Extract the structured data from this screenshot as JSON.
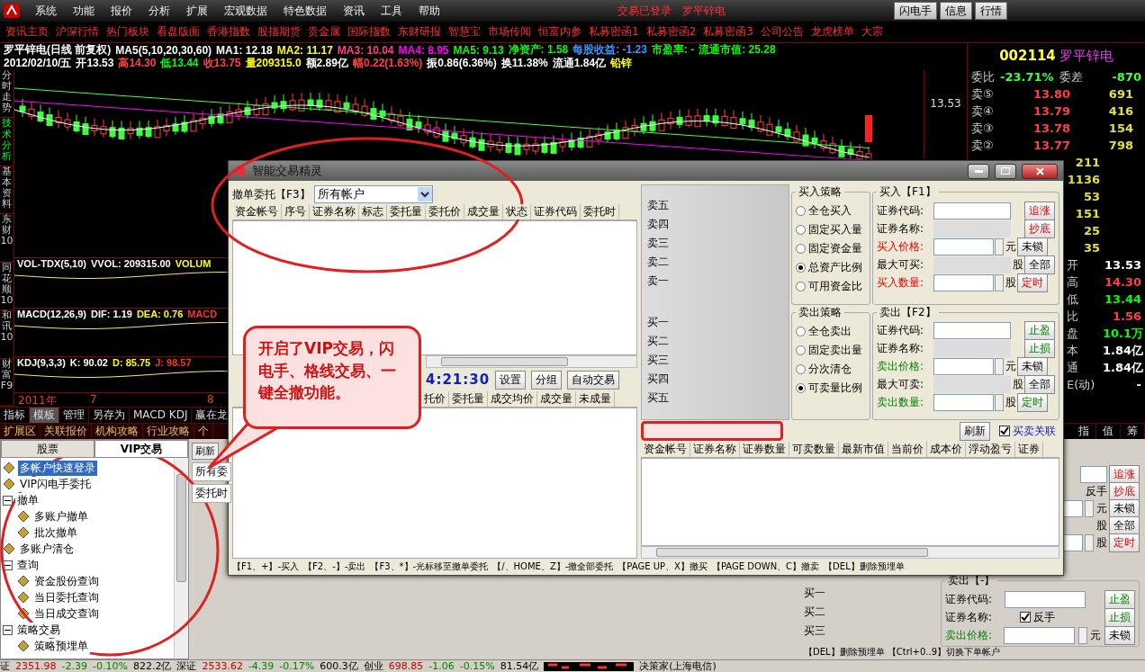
{
  "menu": {
    "items": [
      "系统",
      "功能",
      "报价",
      "分析",
      "扩展",
      "宏观数据",
      "特色数据",
      "资讯",
      "工具",
      "帮助"
    ],
    "status": "交易已登录",
    "stock": "罗平锌电",
    "buttons": [
      "闪电手",
      "信息",
      "行情"
    ]
  },
  "links": [
    "资讯主页",
    "沪深行情",
    "热门板块",
    "看盘版面",
    "香港指数",
    "股指期货",
    "贵金属",
    "国际指数",
    "东财研报",
    "智慧宝",
    "市场传闻",
    "恒富内参",
    "私募密函1",
    "私募密函2",
    "私募密函3",
    "公司公告",
    "龙虎榜单",
    "大宗"
  ],
  "chart": {
    "line1": [
      {
        "text": "罗平锌电(日线 前复权)",
        "color": "#ffffff"
      },
      {
        "text": "MA5(5,10,20,30,60)",
        "color": "#ffffff"
      },
      {
        "text": "MA1: 12.18",
        "color": "#ffffff"
      },
      {
        "text": "MA2: 11.17",
        "color": "#ffff00"
      },
      {
        "text": "MA3: 10.04",
        "color": "#ff4080"
      },
      {
        "text": "MA4: 8.95",
        "color": "#ff00ff"
      },
      {
        "text": "MA5: 9.13",
        "color": "#00ff00"
      },
      {
        "text": "净资产: 1.58",
        "color": "#00ff00"
      },
      {
        "text": "每股收益: -1.23",
        "color": "#3399ff"
      },
      {
        "text": "市盈率: -",
        "color": "#00ff00"
      },
      {
        "text": "流通市值: 25.28",
        "color": "#00ff00"
      }
    ],
    "line2": [
      {
        "text": "2012/02/10/五",
        "color": "#ffffff"
      },
      {
        "text": "开13.53",
        "color": "#ffffff"
      },
      {
        "text": "高14.30",
        "color": "#ff4040"
      },
      {
        "text": "低13.44",
        "color": "#00ff00"
      },
      {
        "text": "收13.75",
        "color": "#ff4040"
      },
      {
        "text": "量209315.0",
        "color": "#ffff00"
      },
      {
        "text": "额2.89亿",
        "color": "#ffffff"
      },
      {
        "text": "幅0.22(1.63%)",
        "color": "#ff4040"
      },
      {
        "text": "振0.86(6.36%)",
        "color": "#ffffff"
      },
      {
        "text": "换11.38%",
        "color": "#ffffff"
      },
      {
        "text": "流通1.84亿",
        "color": "#ffffff"
      },
      {
        "text": "铅锌",
        "color": "#ffff00"
      }
    ],
    "price_label": "13.53",
    "side_tabs": [
      {
        "label": "分时走势",
        "selected": false
      },
      {
        "label": "技术分析",
        "selected": true
      },
      {
        "label": "基本资料",
        "selected": false
      },
      {
        "label": "东财10",
        "selected": false
      },
      {
        "label": "同花顺10",
        "selected": false
      },
      {
        "label": "和讯10",
        "selected": false
      },
      {
        "label": "财富F9",
        "selected": false
      }
    ],
    "indicators": [
      [
        {
          "text": "VOL-TDX(5,10)",
          "color": "#ffffff"
        },
        {
          "text": "VVOL: 209315.00",
          "color": "#ffffff"
        },
        {
          "text": "VOLUM",
          "color": "#ffff00"
        }
      ],
      [
        {
          "text": "MACD(12,26,9)",
          "color": "#ffffff"
        },
        {
          "text": "DIF: 1.19",
          "color": "#ffffff"
        },
        {
          "text": "DEA: 0.76",
          "color": "#ffff00"
        },
        {
          "text": "MACD",
          "color": "#ff3030"
        }
      ],
      [
        {
          "text": "KDJ(9,3,3)",
          "color": "#ffffff"
        },
        {
          "text": "K: 90.02",
          "color": "#ffffff"
        },
        {
          "text": "D: 85.75",
          "color": "#ffff00"
        },
        {
          "text": "J: 98.57",
          "color": "#ff3030"
        }
      ]
    ],
    "axis": [
      "2011年",
      "7",
      "8"
    ],
    "tabs": [
      {
        "label": "指标",
        "selected": false
      },
      {
        "label": "模板",
        "selected": true
      },
      {
        "label": "管理",
        "selected": false
      },
      {
        "label": "另存为",
        "selected": false
      },
      {
        "label": "MACD KDJ",
        "selected": false
      },
      {
        "label": "赢在龙",
        "selected": false
      }
    ],
    "ext_tabs": [
      "扩展区",
      "关联报价",
      "机构攻略",
      "行业攻略",
      "个"
    ]
  },
  "quote": {
    "code": "002114",
    "name": "罗平锌电",
    "ratio_label": "委比",
    "ratio": "-23.71%",
    "diff_label": "委差",
    "diff": "-870",
    "asks": [
      {
        "label": "卖⑤",
        "price": "13.80",
        "volume": "691"
      },
      {
        "label": "卖④",
        "price": "13.79",
        "volume": "416"
      },
      {
        "label": "卖③",
        "price": "13.78",
        "volume": "154"
      },
      {
        "label": "卖②",
        "price": "13.77",
        "volume": "798"
      }
    ],
    "volumes": [
      "211",
      "1136",
      "53",
      "151",
      "25",
      "35"
    ],
    "stats": [
      {
        "label": "开",
        "value": "13.53",
        "color": "#ffffff"
      },
      {
        "label": "高",
        "value": "14.30",
        "color": "#ff4040"
      },
      {
        "label": "低",
        "value": "13.44",
        "color": "#00ff00"
      },
      {
        "label": "比",
        "value": "1.56",
        "color": "#ff4040"
      },
      {
        "label": "盘",
        "value": "10.1万",
        "color": "#00ff00"
      },
      {
        "label": "本",
        "value": "1.84亿",
        "color": "#ffffff"
      },
      {
        "label": "通",
        "value": "1.84亿",
        "color": "#ffffff"
      },
      {
        "label": "E(动)",
        "value": "-",
        "color": "#ffffff"
      }
    ],
    "tabs": [
      "指",
      "值",
      "筹"
    ]
  },
  "tree": {
    "tabs": [
      {
        "label": "股票",
        "selected": false
      },
      {
        "label": "VIP交易",
        "selected": true
      }
    ],
    "items": [
      {
        "label": "多帐户快速登录",
        "selected": true
      },
      {
        "label": "VIP闪电手委托",
        "selected": false
      },
      {
        "label": "撤单",
        "selected": false,
        "expanded": true,
        "children": [
          {
            "label": "多账户撤单",
            "selected": false
          },
          {
            "label": "批次撤单",
            "selected": false
          }
        ]
      },
      {
        "label": "多账户清仓",
        "selected": false
      },
      {
        "label": "查询",
        "selected": false,
        "expanded": true,
        "children": [
          {
            "label": "资金股份查询",
            "selected": false
          },
          {
            "label": "当日委托查询",
            "selected": false
          },
          {
            "label": "当日成交查询",
            "selected": false
          }
        ]
      },
      {
        "label": "策略交易",
        "selected": false,
        "expanded": true,
        "children": [
          {
            "label": "策略预埋单",
            "selected": false
          }
        ]
      }
    ]
  },
  "middle": {
    "refresh": "刷新",
    "tab": "所有委",
    "column": "委托时"
  },
  "lower_order": {
    "rows": [
      {
        "kind": "input",
        "button": {
          "label": "追涨",
          "kind": "red"
        }
      },
      {
        "kind": "none",
        "note": "反手",
        "button": {
          "label": "抄底",
          "kind": "red"
        }
      },
      {
        "kind": "spin",
        "unit": "元",
        "button": {
          "label": "未锁",
          "kind": "plain"
        }
      },
      {
        "kind": "none",
        "unit": "股",
        "button": {
          "label": "全部",
          "kind": "plain"
        }
      },
      {
        "kind": "spin",
        "unit": "股",
        "button": {
          "label": "定时",
          "kind": "red"
        }
      }
    ],
    "book": [
      "买一",
      "买二",
      "买三"
    ],
    "sell_title": "卖出【-】",
    "sell_rows": [
      {
        "label": "证券代码:",
        "kind": "plain",
        "editable": true,
        "spinner": false,
        "button": {
          "label": "止盈",
          "kind": "green"
        }
      },
      {
        "label": "证券名称:",
        "kind": "plain",
        "check": {
          "label": "反手",
          "checked": true
        },
        "button": {
          "label": "止损",
          "kind": "green"
        }
      },
      {
        "label": "卖出价格:",
        "kind": "green",
        "editable": true,
        "spinner": true,
        "unit": "元",
        "button": {
          "label": "未锁",
          "kind": "plain"
        }
      }
    ],
    "hint": "【DEL】删除预埋单 【Ctrl+0..9】切换下单帐户"
  },
  "status_bar": {
    "indices": [
      {
        "name": "证",
        "value": "2351.98",
        "change": "-2.39",
        "pct": "-0.10%",
        "amount": "822.2亿"
      },
      {
        "name": "深证",
        "value": "2533.62",
        "change": "-4.39",
        "pct": "-0.17%",
        "amount": "600.3亿"
      },
      {
        "name": "创业",
        "value": "698.85",
        "change": "-1.06",
        "pct": "-0.15%",
        "amount": "81.54亿"
      }
    ],
    "server": "决策家(上海电信)"
  },
  "dialog": {
    "title": "智能交易精灵",
    "cancel_label": "撤单委托【F3】",
    "account": "所有帐户",
    "cancel_columns": [
      "资金帐号",
      "序号",
      "证券名称",
      "标志",
      "委托量",
      "委托价",
      "成交量",
      "状态",
      "证券代码",
      "委托时"
    ],
    "time": "4:21:30",
    "time_buttons": [
      "设置",
      "分组",
      "自动交易"
    ],
    "order_columns": [
      "托价",
      "委托量",
      "成交均价",
      "成交量",
      "未成量"
    ],
    "asks": [
      "卖五",
      "卖四",
      "卖三",
      "卖二",
      "卖一"
    ],
    "bids": [
      "买一",
      "买二",
      "买三",
      "买四",
      "买五"
    ],
    "buy_strategy": {
      "title": "买入策略",
      "options": [
        {
          "label": "全仓买入",
          "selected": false
        },
        {
          "label": "固定买入量",
          "selected": false
        },
        {
          "label": "固定资金量",
          "selected": false
        },
        {
          "label": "总资产比例",
          "selected": true
        },
        {
          "label": "可用资金比",
          "selected": false
        }
      ]
    },
    "sell_strategy": {
      "title": "卖出策略",
      "options": [
        {
          "label": "全仓卖出",
          "selected": false
        },
        {
          "label": "固定卖出量",
          "selected": false
        },
        {
          "label": "分次清仓",
          "selected": false
        },
        {
          "label": "可卖量比例",
          "selected": true
        }
      ]
    },
    "buy_form": {
      "title": "买入【F1】",
      "rows": [
        {
          "label": "证券代码:",
          "kind": "plain",
          "editable": true,
          "spinner": false,
          "button": {
            "label": "追涨",
            "kind": "red"
          }
        },
        {
          "label": "证券名称:",
          "kind": "plain",
          "editable": false,
          "spinner": false,
          "button": {
            "label": "抄底",
            "kind": "red"
          }
        },
        {
          "label": "买入价格:",
          "kind": "red",
          "editable": true,
          "spinner": true,
          "unit": "元",
          "button": {
            "label": "未锁",
            "kind": "plain"
          }
        },
        {
          "label": "最大可买:",
          "kind": "plain",
          "editable": false,
          "spinner": false,
          "unit": "股",
          "button": {
            "label": "全部",
            "kind": "plain"
          }
        },
        {
          "label": "买入数量:",
          "kind": "red",
          "editable": true,
          "spinner": true,
          "unit": "股",
          "button": {
            "label": "定时",
            "kind": "red"
          }
        }
      ]
    },
    "sell_form": {
      "title": "卖出【F2】",
      "rows": [
        {
          "label": "证券代码:",
          "kind": "plain",
          "editable": true,
          "spinner": false,
          "button": {
            "label": "止盈",
            "kind": "green"
          }
        },
        {
          "label": "证券名称:",
          "kind": "plain",
          "editable": false,
          "spinner": false,
          "button": {
            "label": "止损",
            "kind": "green"
          }
        },
        {
          "label": "卖出价格:",
          "kind": "green",
          "editable": true,
          "spinner": true,
          "unit": "元",
          "button": {
            "label": "未锁",
            "kind": "plain"
          }
        },
        {
          "label": "最大可卖:",
          "kind": "plain",
          "editable": false,
          "spinner": false,
          "unit": "股",
          "button": {
            "label": "全部",
            "kind": "plain"
          }
        },
        {
          "label": "卖出数量:",
          "kind": "green",
          "editable": true,
          "spinner": true,
          "unit": "股",
          "button": {
            "label": "定时",
            "kind": "green"
          }
        }
      ]
    },
    "refresh": "刷新",
    "link_check": {
      "label": "买卖关联",
      "checked": true
    },
    "position_columns": [
      "资金帐号",
      "证券名称",
      "证券数量",
      "可卖数量",
      "最新市值",
      "当前价",
      "成本价",
      "浮动盈亏",
      "证券"
    ],
    "shortcuts": [
      "【F1、+】-买入",
      "【F2、-】-卖出",
      "【F3、*】-光标移至撤单委托",
      "【/、HOME、Z】-撤全部委托",
      "【PAGE UP、X】撤买",
      "【PAGE DOWN、C】撤卖",
      "【DEL】删除预埋单"
    ]
  },
  "callout": "开启了VIP交易，闪电手、格线交易、一键全撤功能。"
}
